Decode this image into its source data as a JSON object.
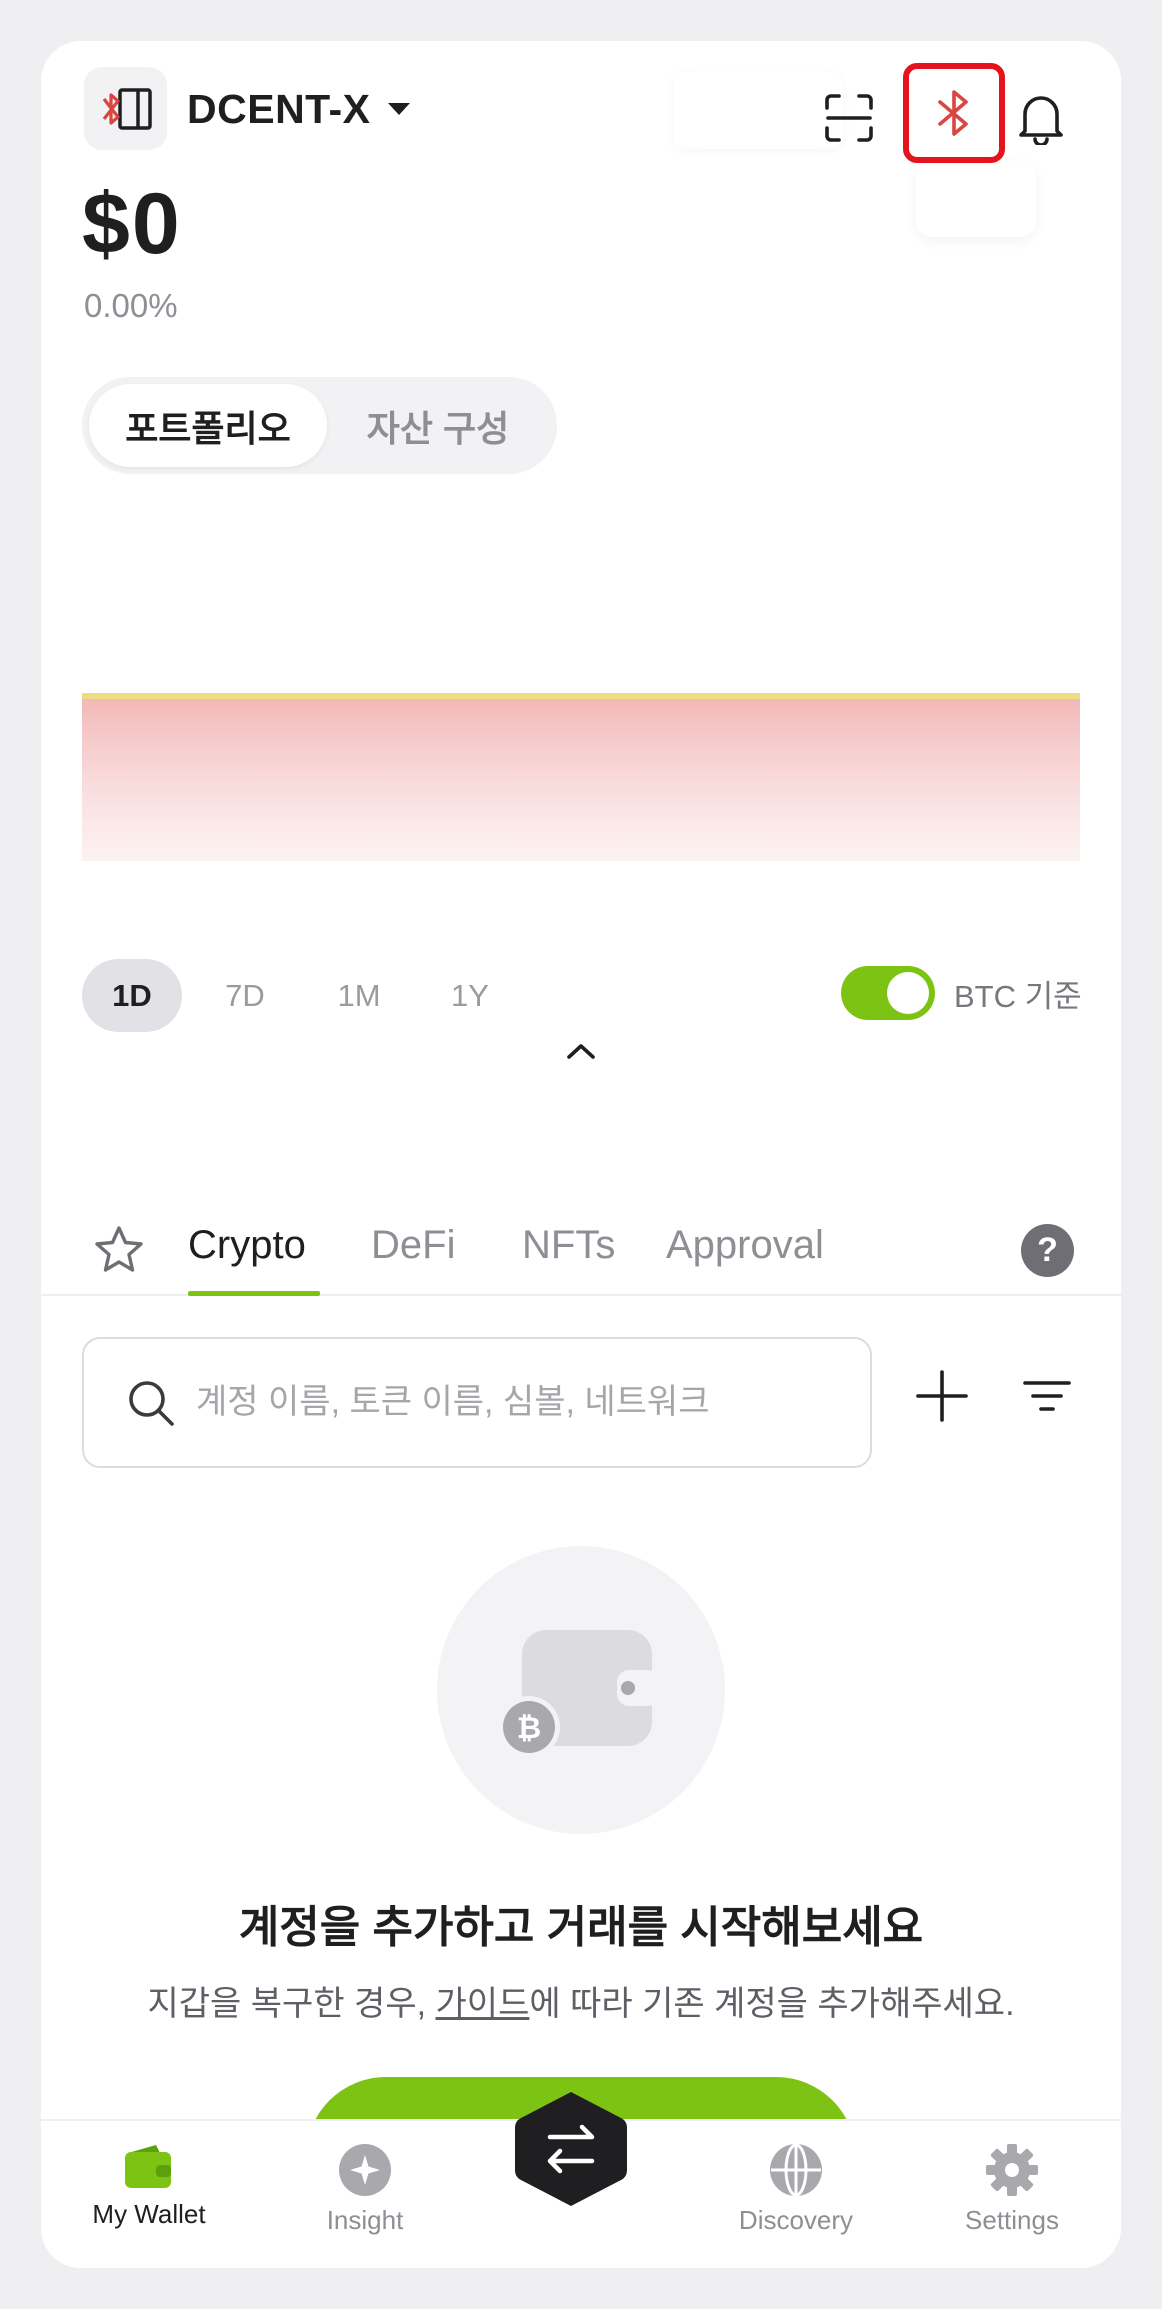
{
  "header": {
    "device_name": "DCENT-X",
    "icons": [
      "device-bluetooth-icon",
      "scan-icon",
      "bluetooth-icon",
      "bell-icon"
    ]
  },
  "balance": {
    "amount": "$0",
    "change": "0.00%"
  },
  "segment": {
    "portfolio": "포트폴리오",
    "composition": "자산 구성"
  },
  "ranges": {
    "d1": "1D",
    "d7": "7D",
    "m1": "1M",
    "y1": "1Y"
  },
  "toggle": {
    "label": "BTC 기준",
    "on": true
  },
  "asset_tabs": {
    "crypto": "Crypto",
    "defi": "DeFi",
    "nfts": "NFTs",
    "approval": "Approval",
    "help": "?"
  },
  "search": {
    "placeholder": "계정 이름, 토큰 이름, 심볼, 네트워크",
    "value": ""
  },
  "empty_state": {
    "title": "계정을 추가하고 거래를 시작해보세요",
    "sub_before": "지갑을 복구한 경우, ",
    "sub_link": "가이드",
    "sub_after": "에 따라 기존 계정을 추가해주세요."
  },
  "nav": {
    "wallet": "My Wallet",
    "insight": "Insight",
    "discovery": "Discovery",
    "settings": "Settings"
  },
  "colors": {
    "accent": "#7cc313",
    "highlight_border": "#e5141c",
    "bluetooth_red": "#d9453f"
  }
}
